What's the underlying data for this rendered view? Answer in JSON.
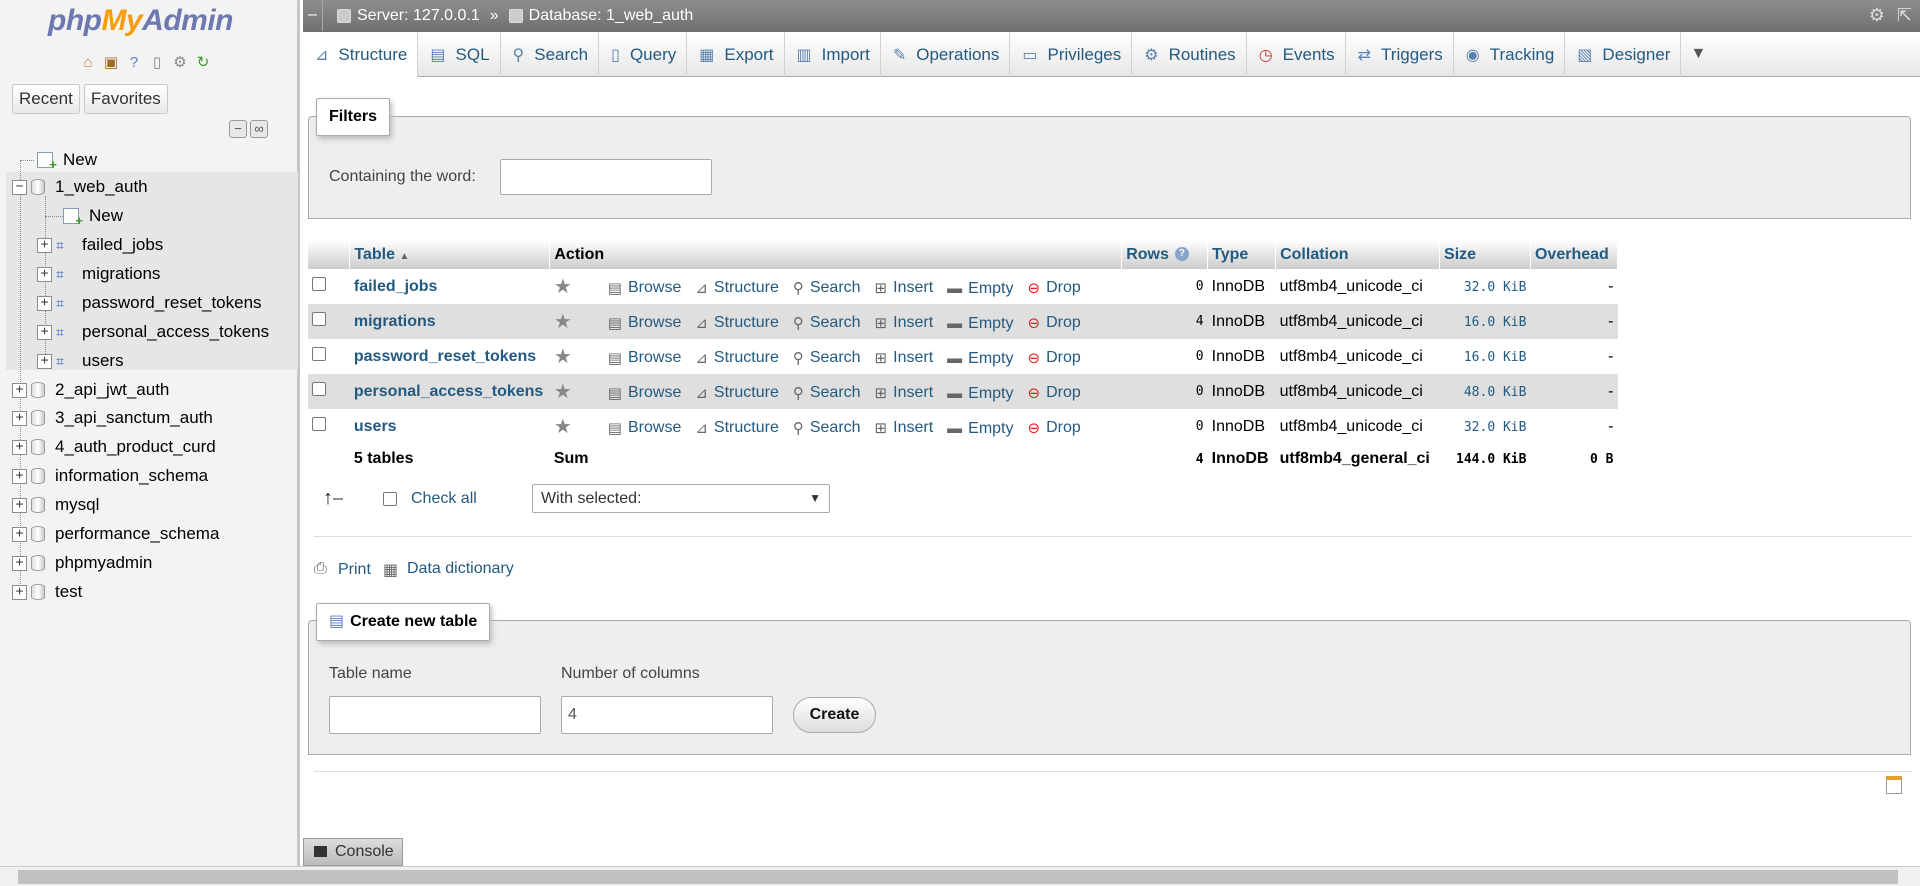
{
  "nav": {
    "logo_php": "php",
    "logo_my": "My",
    "logo_admin": "Admin",
    "quick_icons": [
      "home-icon",
      "exit-icon",
      "help-icon",
      "docs-icon",
      "settings-icon",
      "reload-icon"
    ],
    "tabs": [
      "Recent",
      "Favorites"
    ],
    "tree": {
      "new_label": "New",
      "current_db": "1_web_auth",
      "current_db_new": "New",
      "current_db_tables": [
        "failed_jobs",
        "migrations",
        "password_reset_tokens",
        "personal_access_tokens",
        "users"
      ],
      "other_dbs": [
        "2_api_jwt_auth",
        "3_api_sanctum_auth",
        "4_auth_product_curd",
        "information_schema",
        "mysql",
        "performance_schema",
        "phpmyadmin",
        "test"
      ]
    }
  },
  "topbar": {
    "server": "Server: 127.0.0.1",
    "separator": "»",
    "database": "Database: 1_web_auth"
  },
  "tabs": [
    "Structure",
    "SQL",
    "Search",
    "Query",
    "Export",
    "Import",
    "Operations",
    "Privileges",
    "Routines",
    "Events",
    "Triggers",
    "Tracking",
    "Designer"
  ],
  "active_tab": "Structure",
  "filters": {
    "legend": "Filters",
    "label": "Containing the word:",
    "value": ""
  },
  "table": {
    "headers": {
      "table": "Table",
      "action": "Action",
      "rows": "Rows",
      "type": "Type",
      "collation": "Collation",
      "size": "Size",
      "overhead": "Overhead"
    },
    "actions": [
      "Browse",
      "Structure",
      "Search",
      "Insert",
      "Empty",
      "Drop"
    ],
    "rows": [
      {
        "name": "failed_jobs",
        "rows": "0",
        "type": "InnoDB",
        "collation": "utf8mb4_unicode_ci",
        "size": "32.0 KiB",
        "overhead": "-"
      },
      {
        "name": "migrations",
        "rows": "4",
        "type": "InnoDB",
        "collation": "utf8mb4_unicode_ci",
        "size": "16.0 KiB",
        "overhead": "-"
      },
      {
        "name": "password_reset_tokens",
        "rows": "0",
        "type": "InnoDB",
        "collation": "utf8mb4_unicode_ci",
        "size": "16.0 KiB",
        "overhead": "-"
      },
      {
        "name": "personal_access_tokens",
        "rows": "0",
        "type": "InnoDB",
        "collation": "utf8mb4_unicode_ci",
        "size": "48.0 KiB",
        "overhead": "-"
      },
      {
        "name": "users",
        "rows": "0",
        "type": "InnoDB",
        "collation": "utf8mb4_unicode_ci",
        "size": "32.0 KiB",
        "overhead": "-"
      }
    ],
    "footer": {
      "count": "5 tables",
      "sum": "Sum",
      "rows": "4",
      "type": "InnoDB",
      "collation": "utf8mb4_general_ci",
      "size": "144.0 KiB",
      "overhead": "0 B"
    }
  },
  "bulk": {
    "check_all": "Check all",
    "with_selected": "With selected:"
  },
  "links": {
    "print": "Print",
    "data_dictionary": "Data dictionary"
  },
  "create": {
    "legend": "Create new table",
    "table_name_label": "Table name",
    "table_name_value": "",
    "columns_label": "Number of columns",
    "columns_value": "4",
    "button": "Create"
  },
  "console": "Console",
  "colors": {
    "link": "#235a81",
    "topbar": "#7f7f7f",
    "logo_blue": "#6c78af",
    "logo_orange": "#f89c0e"
  }
}
